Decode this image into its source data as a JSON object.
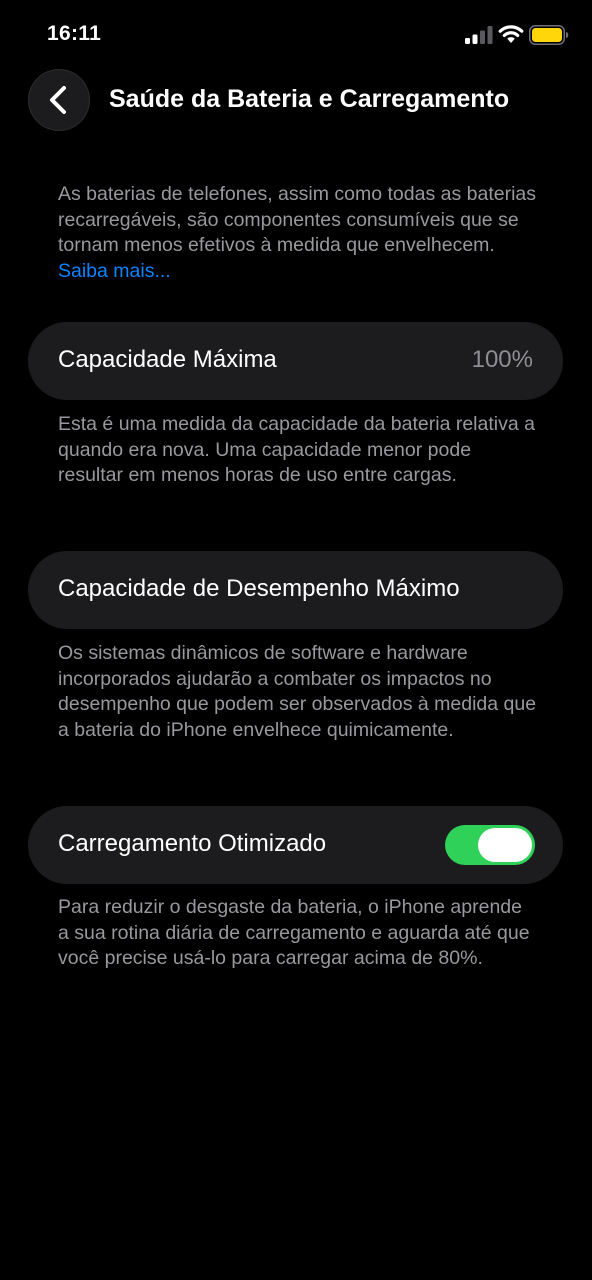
{
  "status_bar": {
    "time": "16:11",
    "icons": [
      "cellular-signal-icon",
      "wifi-icon",
      "battery-icon"
    ],
    "battery_color": "#ffd60a"
  },
  "nav": {
    "back_icon": "chevron-left-icon",
    "title": "Saúde da Bateria e Carregamento"
  },
  "intro": {
    "text": "As baterias de telefones, assim como todas as baterias recarregáveis, são componentes consumíveis que se tornam menos efetivos à medida que envelhecem. ",
    "link": "Saiba mais..."
  },
  "max_capacity": {
    "label": "Capacidade Máxima",
    "value": "100%",
    "description": "Esta é uma medida da capacidade da bateria relativa a quando era nova. Uma capacidade menor pode resultar em menos horas de uso entre cargas."
  },
  "peak_performance": {
    "label": "Capacidade de Desempenho Máximo",
    "description": "Os sistemas dinâmicos de software e hardware incorporados ajudarão a combater os impactos no desempenho que podem ser observados à medida que a bateria do iPhone envelhece quimicamente."
  },
  "optimized_charging": {
    "label": "Carregamento Otimizado",
    "enabled": true,
    "description": "Para reduzir o desgaste da bateria, o iPhone aprende a sua rotina diária de carregamento e aguarda até que você precise usá-lo para carregar acima de 80%."
  },
  "colors": {
    "background": "#000000",
    "card": "#1c1c1e",
    "secondary_text": "#98989e",
    "link": "#0a84ff",
    "toggle_on": "#30d158"
  }
}
